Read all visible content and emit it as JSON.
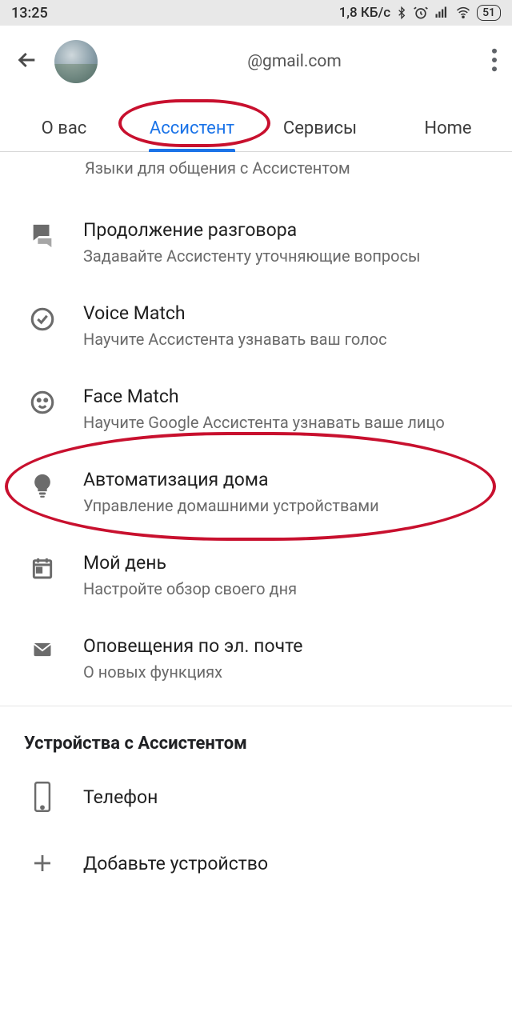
{
  "status": {
    "time": "13:25",
    "net_speed": "1,8 КБ/с",
    "battery": "51"
  },
  "header": {
    "email": "@gmail.com"
  },
  "tabs": {
    "about": "О вас",
    "assistant": "Ассистент",
    "services": "Сервисы",
    "home": "Home"
  },
  "truncated_top_subtitle": "Языки для общения с Ассистентом",
  "items": {
    "continued": {
      "title": "Продолжение разговора",
      "sub": "Задавайте Ассистенту уточняющие вопросы"
    },
    "voice": {
      "title": "Voice Match",
      "sub": "Научите Ассистента узнавать ваш голос"
    },
    "face": {
      "title": "Face Match",
      "sub": "Научите Google Ассистента узнавать ваше лицо"
    },
    "home_auto": {
      "title": "Автоматизация дома",
      "sub": "Управление домашними устройствами"
    },
    "my_day": {
      "title": "Мой день",
      "sub": "Настройте обзор своего дня"
    },
    "email": {
      "title": "Оповещения по эл. почте",
      "sub": "О новых функциях"
    }
  },
  "devices_header": "Устройства с Ассистентом",
  "devices": {
    "phone": "Телефон",
    "add": "Добавьте устройство"
  }
}
